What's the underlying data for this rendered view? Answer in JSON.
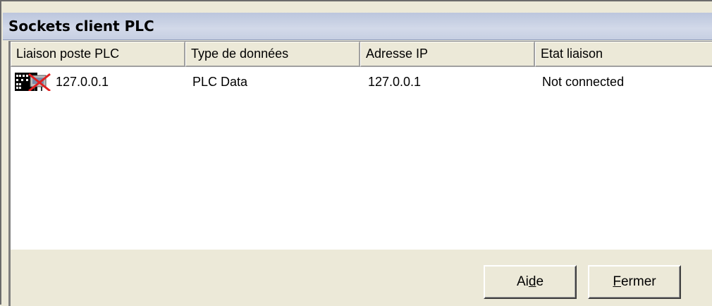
{
  "window": {
    "title": "Sockets client PLC"
  },
  "list": {
    "columns": [
      "Liaison poste PLC",
      "Type de données",
      "Adresse IP",
      "Etat liaison"
    ],
    "rows": [
      {
        "icon": "plc-disconnected-icon",
        "cells": [
          "127.0.0.1",
          "PLC Data",
          "127.0.0.1",
          "Not connected"
        ]
      }
    ]
  },
  "buttons": {
    "help": {
      "pre": "Ai",
      "accel": "d",
      "post": "e"
    },
    "close": {
      "pre": "",
      "accel": "F",
      "post": "ermer"
    }
  },
  "colors": {
    "titlebar": "#c6cfe2",
    "face": "#ece9d8",
    "disconnected_mark": "#e02020"
  }
}
